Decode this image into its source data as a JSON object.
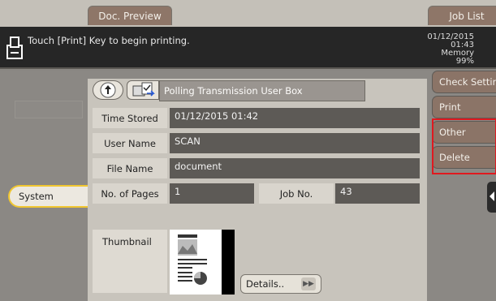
{
  "tabs": {
    "doc_preview": "Doc. Preview",
    "job_list": "Job List"
  },
  "status": {
    "message": "Touch [Print] Key to begin printing.",
    "date": "01/12/2015",
    "time": "01:43",
    "memory_label": "Memory",
    "memory_value": "99%"
  },
  "left": {
    "system_label": "System"
  },
  "box": {
    "title": "Polling Transmission User Box"
  },
  "fields": {
    "time_stored_label": "Time Stored",
    "time_stored_value": "01/12/2015 01:42",
    "user_name_label": "User Name",
    "user_name_value": "SCAN",
    "file_name_label": "File Name",
    "file_name_value": "document",
    "pages_label": "No. of Pages",
    "pages_value": "1",
    "job_no_label": "Job No.",
    "job_no_value": "43"
  },
  "thumbnail": {
    "label": "Thumbnail",
    "details_label": "Details.."
  },
  "actions": {
    "check_setting": "Check Setting",
    "print": "Print",
    "other": "Other",
    "delete": "Delete"
  },
  "colors": {
    "highlight": "#e0191f",
    "system_outline": "#f0c630"
  },
  "icons": [
    "printer-icon",
    "up-arrow-icon",
    "user-box-icon",
    "double-right-arrow-icon",
    "left-arrow-icon"
  ]
}
